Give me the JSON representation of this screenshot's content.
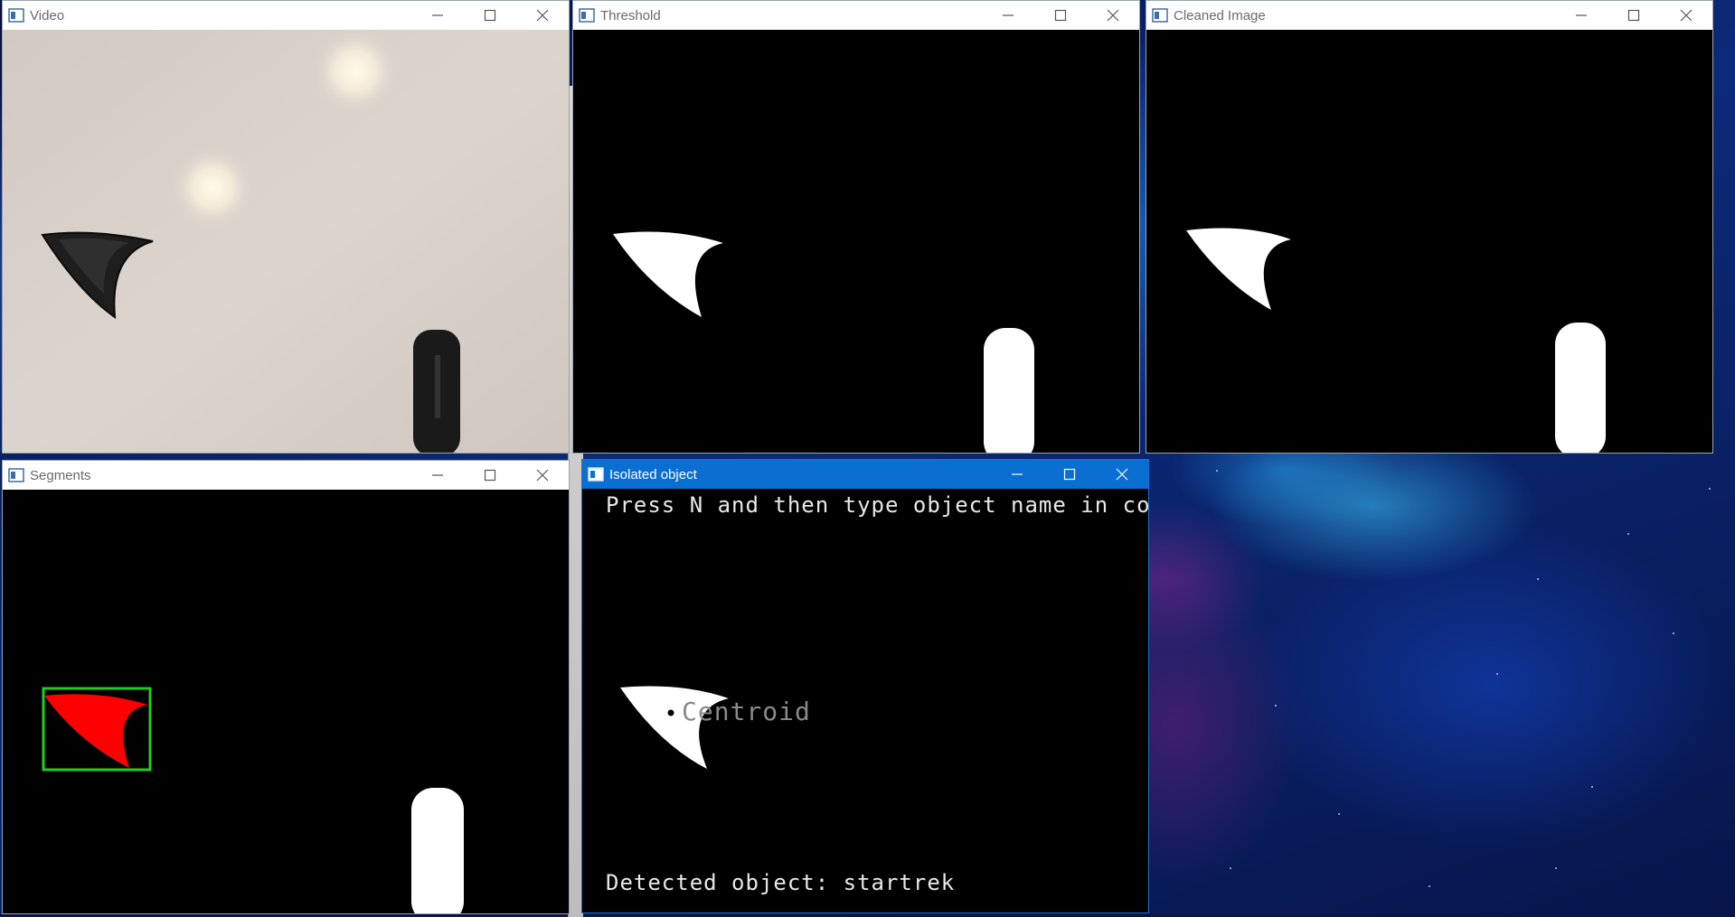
{
  "windows": {
    "video": {
      "title": "Video"
    },
    "threshold": {
      "title": "Threshold"
    },
    "cleaned": {
      "title": "Cleaned Image"
    },
    "segments": {
      "title": "Segments"
    },
    "isolated": {
      "title": "Isolated object",
      "instruction": "Press N and then type object name in console",
      "centroid_label": "Centroid",
      "detected_text": "Detected object: startrek"
    }
  },
  "icons": {
    "app": "opencv-window-icon",
    "minimize": "minimize-icon",
    "maximize": "maximize-icon",
    "close": "close-icon"
  },
  "colors": {
    "active_titlebar": "#0a6fd0",
    "segment_fill": "#ff0000",
    "bounding_box": "#22cc22",
    "object": "#ffffff",
    "background": "#000000"
  }
}
